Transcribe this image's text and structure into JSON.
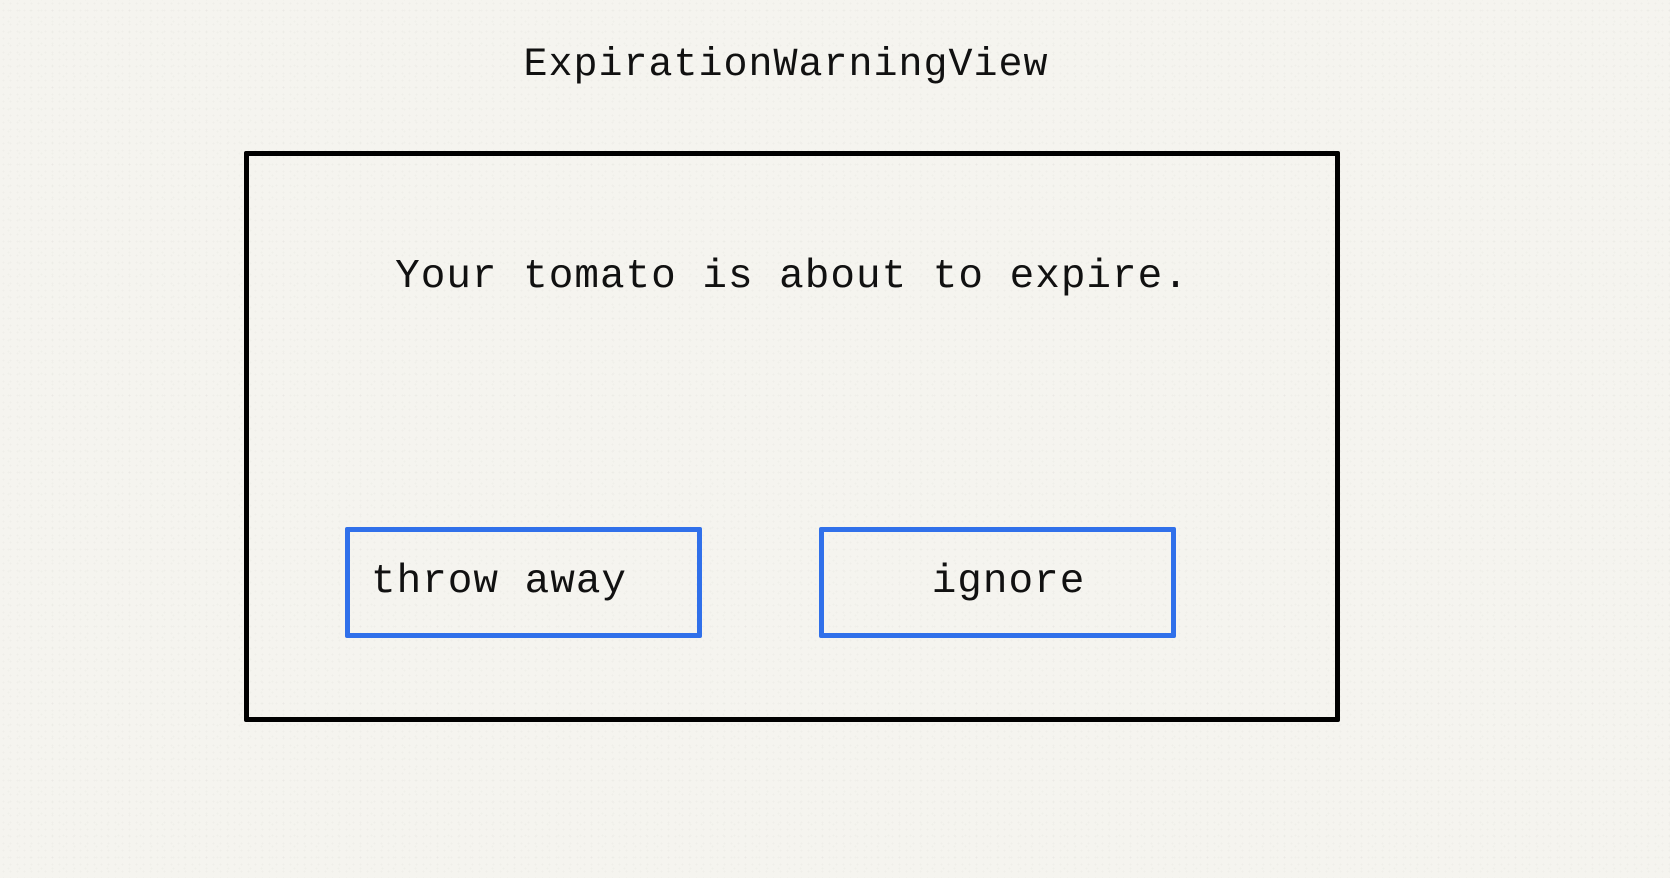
{
  "view": {
    "title": "ExpirationWarningView",
    "message": "Your tomato is about to expire.",
    "buttons": {
      "throw_away": "throw away",
      "ignore": "ignore"
    }
  },
  "colors": {
    "frame_border": "#000000",
    "button_border": "#3070ea",
    "background": "#f5f4ef"
  }
}
